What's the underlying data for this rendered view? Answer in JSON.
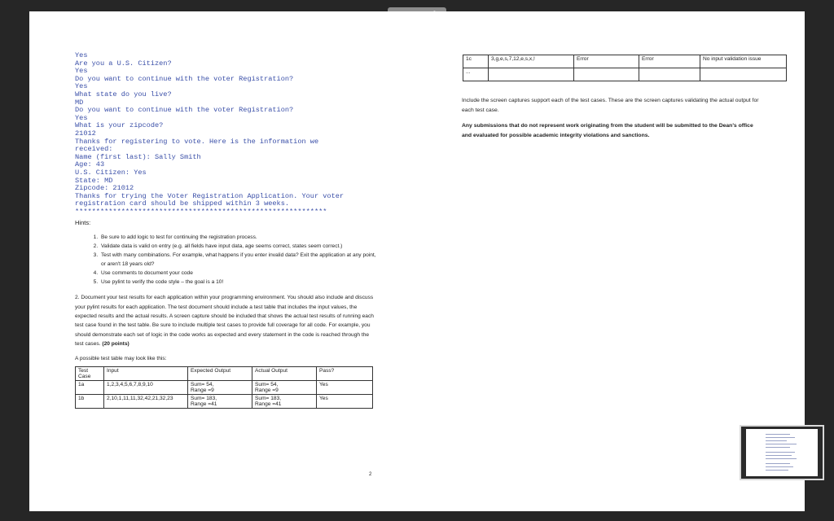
{
  "viewer": {
    "page_indicator": "Page 2 of 3"
  },
  "left_page": {
    "console_lines": [
      "Yes",
      "Are you a U.S. Citizen?",
      "Yes",
      "Do you want to continue with the voter Registration?",
      "Yes",
      "What state do you live?",
      "MD",
      "Do you want to continue with the voter Registration?",
      "Yes",
      "What is your zipcode?",
      "21012",
      "Thanks for registering to vote. Here is the information we",
      "received:",
      "Name (first last): Sally Smith",
      "Age: 43",
      "U.S. Citizen: Yes",
      "State: MD",
      "Zipcode: 21012",
      "Thanks for trying the Voter Registration Application. Your voter",
      "registration card should be shipped within 3 weeks.",
      "************************************************************"
    ],
    "hints_label": "Hints:",
    "hints": [
      "Be sure to add logic to test for continuing the registration process.",
      "Validate data is valid on entry (e.g. all fields have input data, age seems correct, states seem correct.)",
      "Test with many combinations. For example, what happens if you enter invalid data? Exit the application at any point, or aren't 18 years old?",
      "Use comments to document your code",
      "Use pylint to verify the code style – the goal is a 10!"
    ],
    "task_text": "2. Document your test results for each application within your programming environment. You should also include and discuss your pylint results for each application. The test document should include a test table that includes the input values, the expected results and the actual results. A screen capture should be included that shows the actual test results of running each test case found in the test table. Be sure to include multiple test cases to provide full coverage for all code. For example, you should demonstrate each set of logic in the code works as expected and every statement in the code is reached through the test cases.",
    "task_points": "(20 points)",
    "possible_label": "A possible test table may look like this:",
    "table": {
      "headers": [
        "Test Case",
        "Input",
        "Expected Output",
        "Actual Output",
        "Pass?"
      ],
      "rows": [
        [
          "1a",
          "1,2,3,4,5,6,7,8,9,10",
          "Sum= 54,\nRange =9",
          "Sum= 54,\nRange =9",
          "Yes"
        ],
        [
          "1b",
          "2,10,1,11,11,32,42,21,32,23",
          "Sum= 183,\nRange =41",
          "Sum= 183,\nRange =41",
          "Yes"
        ]
      ]
    },
    "page_number": "2"
  },
  "right_page": {
    "table_rows": [
      [
        "1c",
        "3,g,e,s,7,12,e,s,x,!",
        "Error",
        "Error",
        "No input validation issue"
      ],
      [
        "...",
        "",
        "",
        "",
        ""
      ]
    ],
    "note_text": "Include the screen captures support each of the test cases. These are the screen captures validating the actual output for each test case.",
    "warning_text": "Any submissions that do not represent work originating from the student will be submitted to the Dean's office and evaluated for possible academic integrity violations and sanctions."
  }
}
